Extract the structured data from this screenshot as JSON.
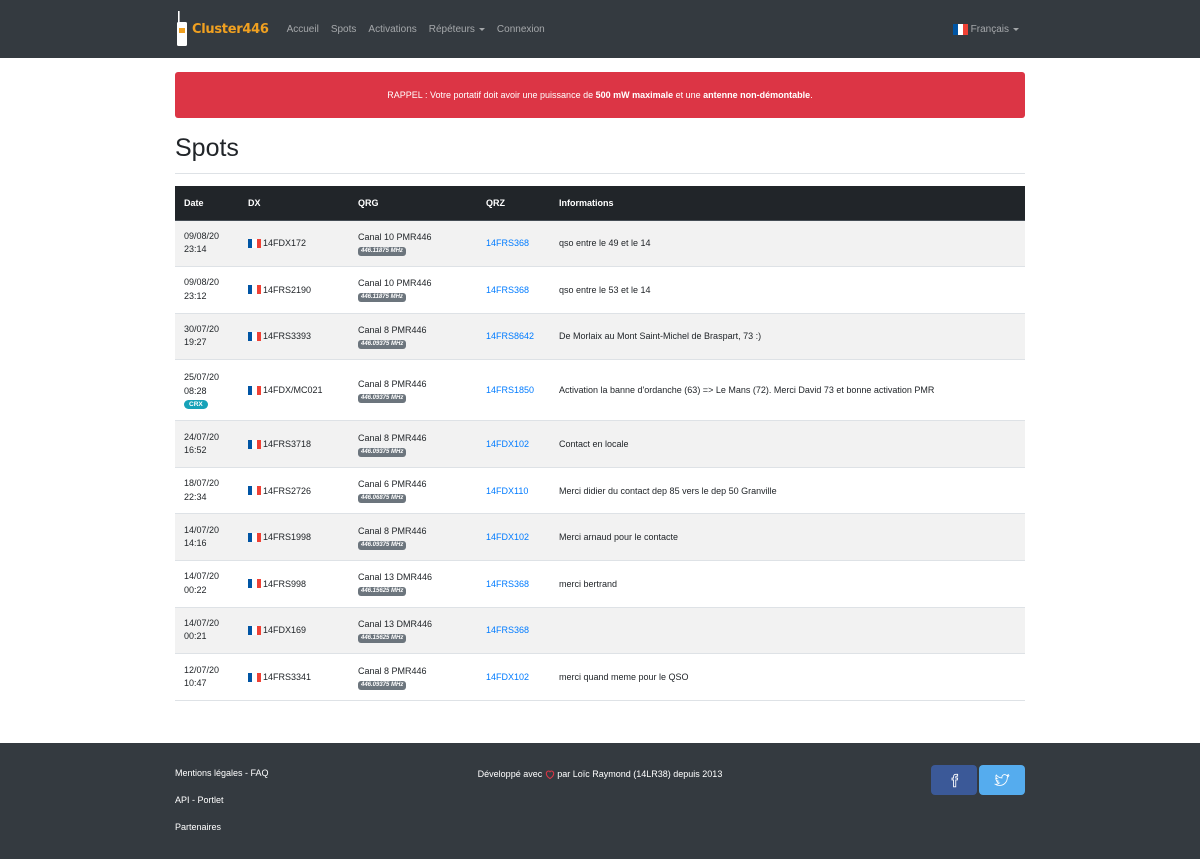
{
  "navbar": {
    "brand": "Cluster446",
    "links": [
      {
        "label": "Accueil"
      },
      {
        "label": "Spots"
      },
      {
        "label": "Activations"
      },
      {
        "label": "Répéteurs"
      },
      {
        "label": "Connexion"
      }
    ],
    "language": "Français"
  },
  "alert": {
    "prefix": "RAPPEL : Votre portatif doit avoir une puissance de ",
    "bold1": "500 mW maximale",
    "middle": " et une ",
    "bold2": "antenne non-démontable",
    "suffix": "."
  },
  "page_title": "Spots",
  "table": {
    "headers": [
      "Date",
      "DX",
      "QRG",
      "QRZ",
      "Informations"
    ],
    "rows": [
      {
        "date": "09/08/20",
        "time": "23:14",
        "dx": "14FDX172",
        "qrg": "Canal 10 PMR446",
        "freq": "446.11875 MHz",
        "qrz": "14FRS368",
        "info": "qso entre le 49 et le 14"
      },
      {
        "date": "09/08/20",
        "time": "23:12",
        "dx": "14FRS2190",
        "qrg": "Canal 10 PMR446",
        "freq": "446.11875 MHz",
        "qrz": "14FRS368",
        "info": "qso entre le 53 et le 14"
      },
      {
        "date": "30/07/20",
        "time": "19:27",
        "dx": "14FRS3393",
        "qrg": "Canal 8 PMR446",
        "freq": "446.09375 MHz",
        "qrz": "14FRS8642",
        "info": "De Morlaix au Mont Saint-Michel de Braspart, 73 :)"
      },
      {
        "date": "25/07/20",
        "time": "08:28",
        "badge": "CRX",
        "dx": "14FDX/MC021",
        "qrg": "Canal 8 PMR446",
        "freq": "446.09375 MHz",
        "qrz": "14FRS1850",
        "info": "Activation la banne d'ordanche (63) => Le Mans (72). Merci David 73 et bonne activation PMR"
      },
      {
        "date": "24/07/20",
        "time": "16:52",
        "dx": "14FRS3718",
        "qrg": "Canal 8 PMR446",
        "freq": "446.09375 MHz",
        "qrz": "14FDX102",
        "info": "Contact en locale"
      },
      {
        "date": "18/07/20",
        "time": "22:34",
        "dx": "14FRS2726",
        "qrg": "Canal 6 PMR446",
        "freq": "446.06875 MHz",
        "qrz": "14FDX110",
        "info": "Merci didier du contact dep 85 vers le dep 50 Granville"
      },
      {
        "date": "14/07/20",
        "time": "14:16",
        "dx": "14FRS1998",
        "qrg": "Canal 8 PMR446",
        "freq": "446.09375 MHz",
        "qrz": "14FDX102",
        "info": "Merci arnaud pour le contacte"
      },
      {
        "date": "14/07/20",
        "time": "00:22",
        "dx": "14FRS998",
        "qrg": "Canal 13 DMR446",
        "freq": "446.15625 MHz",
        "qrz": "14FRS368",
        "info": "merci bertrand"
      },
      {
        "date": "14/07/20",
        "time": "00:21",
        "dx": "14FDX169",
        "qrg": "Canal 13 DMR446",
        "freq": "446.15625 MHz",
        "qrz": "14FRS368",
        "info": ""
      },
      {
        "date": "12/07/20",
        "time": "10:47",
        "dx": "14FRS3341",
        "qrg": "Canal 8 PMR446",
        "freq": "446.09375 MHz",
        "qrz": "14FDX102",
        "info": "merci quand meme pour le QSO"
      }
    ]
  },
  "footer": {
    "links": [
      {
        "label": "Mentions légales - FAQ"
      },
      {
        "label": "API - Portlet"
      },
      {
        "label": "Partenaires"
      }
    ],
    "credit_prefix": "Développé avec ",
    "credit_suffix": " par Loïc Raymond (14LR38) depuis 2013"
  },
  "colors": {
    "navbar": "#343a40",
    "alert": "#dc3545",
    "link": "#007bff",
    "badge_crx": "#17a2b8",
    "facebook": "#3b5998",
    "twitter": "#55acee"
  }
}
